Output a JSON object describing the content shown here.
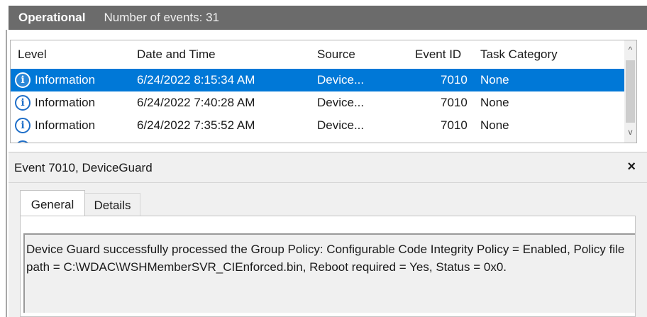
{
  "log": {
    "title": "Operational",
    "event_count": "Number of events: 31"
  },
  "table": {
    "columns": [
      "Level",
      "Date and Time",
      "Source",
      "Event ID",
      "Task Category"
    ],
    "rows": [
      {
        "level": "Information",
        "datetime": "6/24/2022 8:15:34 AM",
        "source": "Device...",
        "event_id": "7010",
        "category": "None",
        "selected": true
      },
      {
        "level": "Information",
        "datetime": "6/24/2022 7:40:28 AM",
        "source": "Device...",
        "event_id": "7010",
        "category": "None",
        "selected": false
      },
      {
        "level": "Information",
        "datetime": "6/24/2022 7:35:52 AM",
        "source": "Device...",
        "event_id": "7010",
        "category": "None",
        "selected": false
      }
    ]
  },
  "icons": {
    "info": "i",
    "scroll_up": "^",
    "scroll_down": "v",
    "close": "×"
  },
  "detail": {
    "title": "Event 7010, DeviceGuard",
    "tabs": [
      "General",
      "Details"
    ],
    "message": "Device Guard successfully processed the Group Policy: Configurable Code Integrity Policy = Enabled,  Policy file path = C:\\WDAC\\WSHMemberSVR_CIEnforced.bin, Reboot required = Yes, Status = 0x0."
  },
  "colors": {
    "title_bar": "#6b6b6b",
    "selection": "#0078d7",
    "info_icon": "#1e6ec8"
  }
}
